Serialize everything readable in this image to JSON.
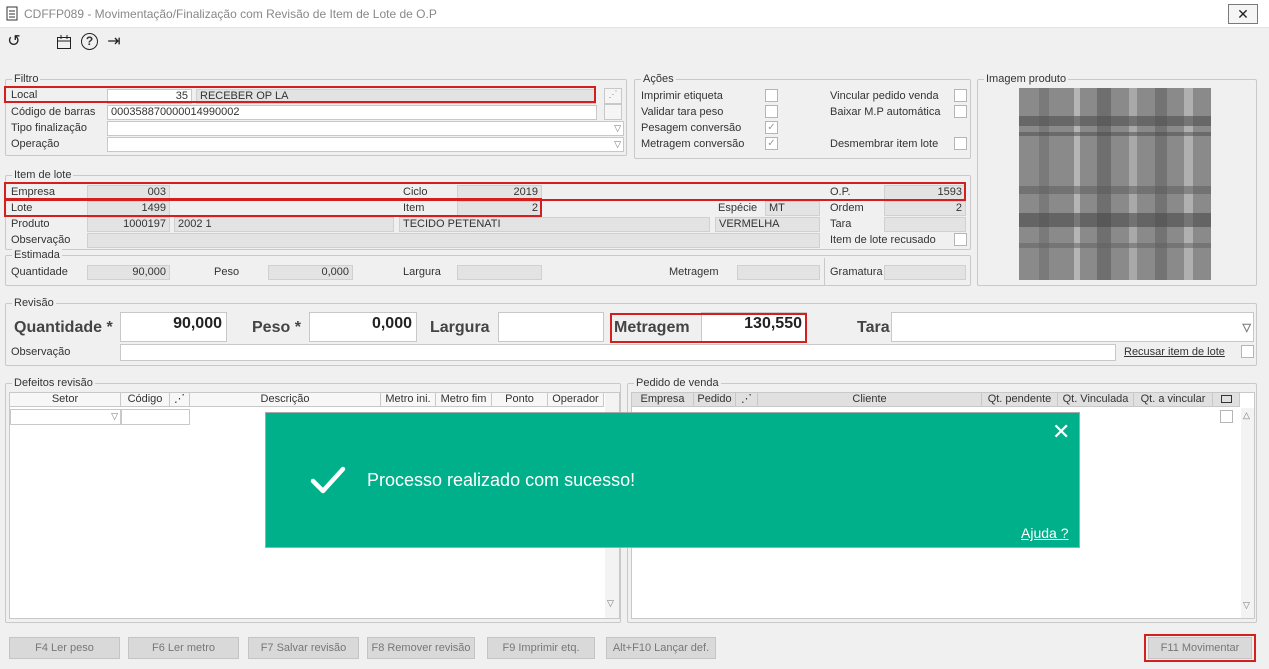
{
  "window": {
    "title": "CDFFP089 - Movimentação/Finalização com Revisão de Item de Lote de O.P",
    "close": "✕"
  },
  "toolbar": {
    "refresh": "↺",
    "calendar": "▦",
    "help": "?",
    "exit": "⇥"
  },
  "filtro": {
    "legend": "Filtro",
    "local_label": "Local",
    "local_code": "35",
    "local_name": "RECEBER OP LA",
    "codigo_label": "Código de barras",
    "codigo_value": "000358870000014990002",
    "tipo_label": "Tipo finalização",
    "operacao_label": "Operação"
  },
  "acoes": {
    "legend": "Ações",
    "imprimir": "Imprimir etiqueta",
    "validar": "Validar tara peso",
    "pesagem": "Pesagem conversão",
    "metragem": "Metragem conversão",
    "vincular": "Vincular pedido venda",
    "baixar": "Baixar M.P automática",
    "desmembrar": "Desmembrar item lote",
    "check_mark": "✓"
  },
  "imagem": {
    "legend": "Imagem produto"
  },
  "item_lote": {
    "legend": "Item de lote",
    "empresa_label": "Empresa",
    "empresa": "003",
    "ciclo_label": "Ciclo",
    "ciclo": "2019",
    "op_label": "O.P.",
    "op": "1593",
    "lote_label": "Lote",
    "lote": "1499",
    "item_label": "Item",
    "item": "2",
    "especie_label": "Espécie",
    "especie": "MT",
    "ordem_label": "Ordem",
    "ordem": "2",
    "produto_label": "Produto",
    "produto_code": "1000197",
    "produto_ref": "2002 1",
    "produto_desc": "TECIDO PETENATI",
    "produto_cor": "VERMELHA",
    "tara_label": "Tara",
    "observacao_label": "Observação",
    "recusado_label": "Item de lote recusado"
  },
  "estimada": {
    "legend": "Estimada",
    "quantidade_label": "Quantidade",
    "quantidade": "90,000",
    "peso_label": "Peso",
    "peso": "0,000",
    "largura_label": "Largura",
    "metragem_label": "Metragem",
    "gramatura_label": "Gramatura"
  },
  "revisao": {
    "legend": "Revisão",
    "quantidade_label": "Quantidade *",
    "quantidade": "90,000",
    "peso_label": "Peso *",
    "peso": "0,000",
    "largura_label": "Largura",
    "metragem_label": "Metragem",
    "metragem": "130,550",
    "tara_label": "Tara",
    "observacao_label": "Observação",
    "recusar_label": "Recusar item de lote"
  },
  "defeitos": {
    "legend": "Defeitos revisão",
    "columns": [
      "Setor",
      "Código",
      "",
      "Descrição",
      "Metro ini.",
      "Metro fim",
      "Ponto",
      "Operador"
    ]
  },
  "pedido": {
    "legend": "Pedido de venda",
    "columns": [
      "Empresa",
      "Pedido",
      "",
      "Cliente",
      "Qt. pendente",
      "Qt. Vinculada",
      "Qt. a vincular"
    ]
  },
  "buttons": {
    "f4": "F4 Ler peso",
    "f6": "F6 Ler metro",
    "f7": "F7 Salvar revisão",
    "f8": "F8 Remover revisão",
    "f9": "F9 Imprimir etq.",
    "altf10": "Alt+F10 Lançar def.",
    "f11": "F11 Movimentar"
  },
  "toast": {
    "message": "Processo realizado com sucesso!",
    "close": "✕",
    "help": "Ajuda ?"
  },
  "colors": {
    "toast_bg": "#00b08a",
    "highlight": "#d21f1f"
  }
}
